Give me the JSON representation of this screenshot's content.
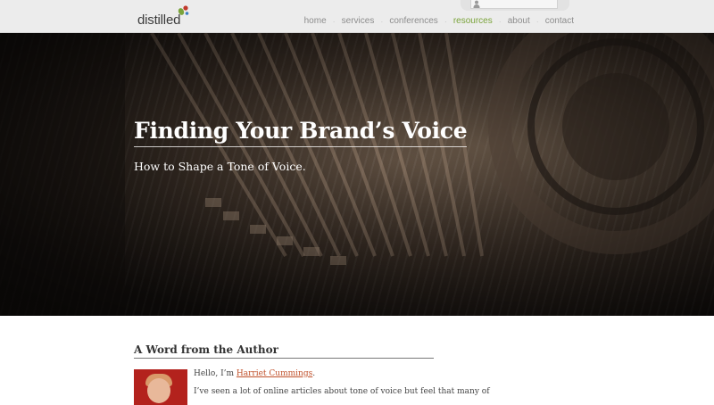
{
  "brand": {
    "logo_text": "distilled",
    "logo_colors": [
      "#7aa33a",
      "#c0392b",
      "#3b7ec2"
    ]
  },
  "nav": {
    "items": [
      {
        "label": "home",
        "active": false
      },
      {
        "label": "services",
        "active": false
      },
      {
        "label": "conferences",
        "active": false
      },
      {
        "label": "resources",
        "active": true
      },
      {
        "label": "about",
        "active": false
      },
      {
        "label": "contact",
        "active": false
      }
    ],
    "active_color": "#7aa33a"
  },
  "hero": {
    "title": "Finding Your Brand’s Voice",
    "subtitle": "How to Shape a Tone of Voice."
  },
  "article": {
    "section_title": "A Word from the Author",
    "greeting_prefix": "Hello, I’m ",
    "author_name": "Harriet Cummings",
    "greeting_suffix": ".",
    "paragraph": "I’ve seen a lot of online articles about tone of voice but feel that many of"
  }
}
